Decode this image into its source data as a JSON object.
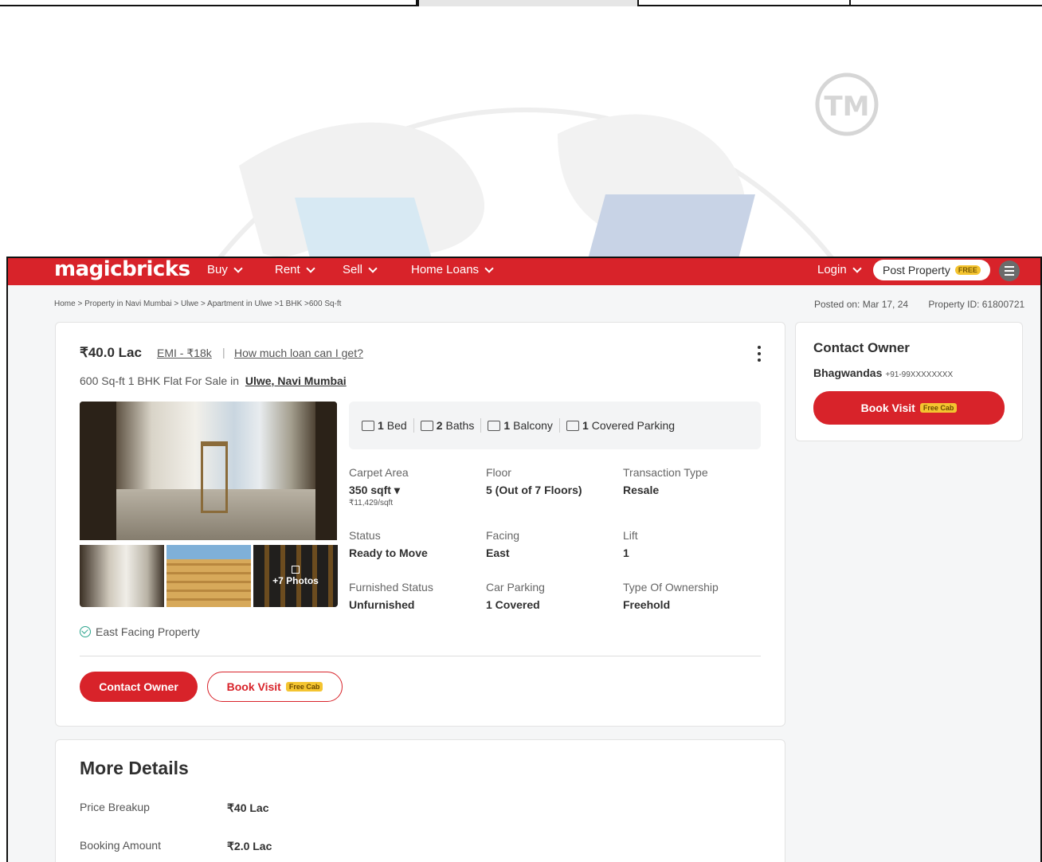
{
  "nav": {
    "logo": "magicbricks",
    "items": [
      "Buy",
      "Rent",
      "Sell",
      "Home Loans"
    ],
    "login": "Login",
    "post_property": "Post Property",
    "post_badge": "FREE"
  },
  "breadcrumb": "Home > Property in Navi Mumbai > Ulwe > Apartment in Ulwe >1 BHK >600 Sq-ft",
  "meta": {
    "posted_on": "Posted on: Mar 17, 24",
    "property_id": "Property ID: 61800721"
  },
  "listing": {
    "price": "₹40.0 Lac",
    "emi": "EMI - ₹18k",
    "separator": "|",
    "loan_link": "How much loan can I get?",
    "subtitle_prefix": "600 Sq-ft 1 BHK Flat For Sale in",
    "location": "Ulwe, Navi Mumbai",
    "photos_more": "+7 Photos",
    "amenities": [
      {
        "count": "1",
        "label": "Bed"
      },
      {
        "count": "2",
        "label": "Baths"
      },
      {
        "count": "1",
        "label": "Balcony"
      },
      {
        "count": "1",
        "label": "Covered Parking"
      }
    ],
    "specs": [
      {
        "label": "Carpet Area",
        "value": "350 sqft",
        "sub": "₹11,429/sqft"
      },
      {
        "label": "Floor",
        "value": "5 (Out of 7 Floors)"
      },
      {
        "label": "Transaction Type",
        "value": "Resale"
      },
      {
        "label": "Status",
        "value": "Ready to Move"
      },
      {
        "label": "Facing",
        "value": "East"
      },
      {
        "label": "Lift",
        "value": "1"
      },
      {
        "label": "Furnished Status",
        "value": "Unfurnished"
      },
      {
        "label": "Car Parking",
        "value": "1 Covered"
      },
      {
        "label": "Type Of Ownership",
        "value": "Freehold"
      }
    ],
    "highlight": "East Facing Property",
    "contact_btn": "Contact Owner",
    "book_btn": "Book Visit",
    "cab_badge": "Free Cab"
  },
  "side": {
    "title": "Contact Owner",
    "owner": "Bhagwandas",
    "phone": "+91-99XXXXXXXX",
    "book_btn": "Book Visit",
    "cab_badge": "Free Cab"
  },
  "more": {
    "title": "More Details",
    "rows": [
      {
        "label": "Price Breakup",
        "value": "₹40 Lac"
      },
      {
        "label": "Booking Amount",
        "value": "₹2.0 Lac"
      }
    ]
  },
  "watermark": {
    "mark": "TM"
  },
  "colors": {
    "brand": "#d8232a",
    "badge": "#f4c430",
    "success": "#2ca58d"
  }
}
